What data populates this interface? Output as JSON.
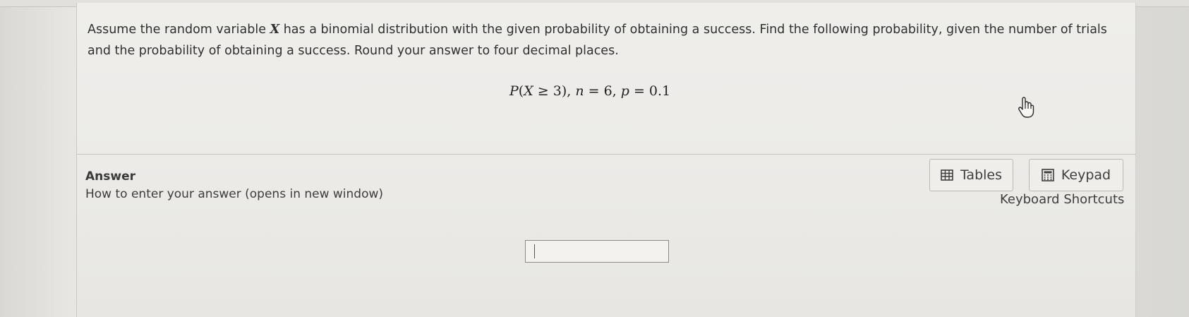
{
  "question": {
    "text_before_var": "Assume the random variable ",
    "var": "X",
    "text_after_var": " has a binomial distribution with the given probability of obtaining a success. Find the following probability, given the number of trials and the probability of obtaining a success. Round your answer to four decimal places."
  },
  "formula": {
    "p": "P",
    "open": "(",
    "x": "X",
    "ge": " ≥ 3), ",
    "n": "n",
    "n_val": " = 6, ",
    "pp": "p",
    "p_val": " = 0.1"
  },
  "answer": {
    "label": "Answer",
    "how_link": "How to enter your answer (opens in new window)",
    "input_value": ""
  },
  "toolbar": {
    "tables_label": "Tables",
    "keypad_label": "Keypad",
    "shortcuts_label": "Keyboard Shortcuts"
  },
  "icons": {
    "tables": "table-grid-icon",
    "keypad": "calculator-icon",
    "cursor": "hand-pointer-icon"
  }
}
